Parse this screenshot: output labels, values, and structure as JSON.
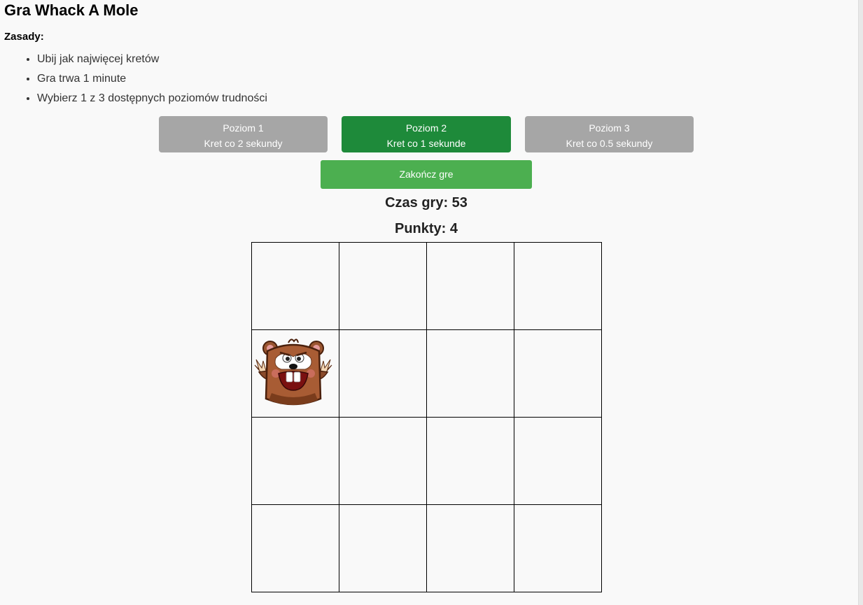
{
  "title": "Gra Whack A Mole",
  "rules": {
    "heading": "Zasady:",
    "items": [
      "Ubij jak najwięcej kretów",
      "Gra trwa 1 minute",
      "Wybierz 1 z 3 dostępnych poziomów trudności"
    ]
  },
  "levels": [
    {
      "name": "Poziom 1",
      "desc": "Kret co 2 sekundy",
      "active": false
    },
    {
      "name": "Poziom 2",
      "desc": "Kret co 1 sekunde",
      "active": true
    },
    {
      "name": "Poziom 3",
      "desc": "Kret co 0.5 sekundy",
      "active": false
    }
  ],
  "end_button": "Zakończ gre",
  "time_text": "Czas gry: 53",
  "score_text": "Punkty: 4",
  "board": {
    "rows": 4,
    "cols": 4,
    "mole_position": {
      "row": 2,
      "col": 1
    }
  },
  "colors": {
    "active_level": "#1e8a3a",
    "inactive_level": "#a6a6a6",
    "end_button": "#4caf50"
  }
}
